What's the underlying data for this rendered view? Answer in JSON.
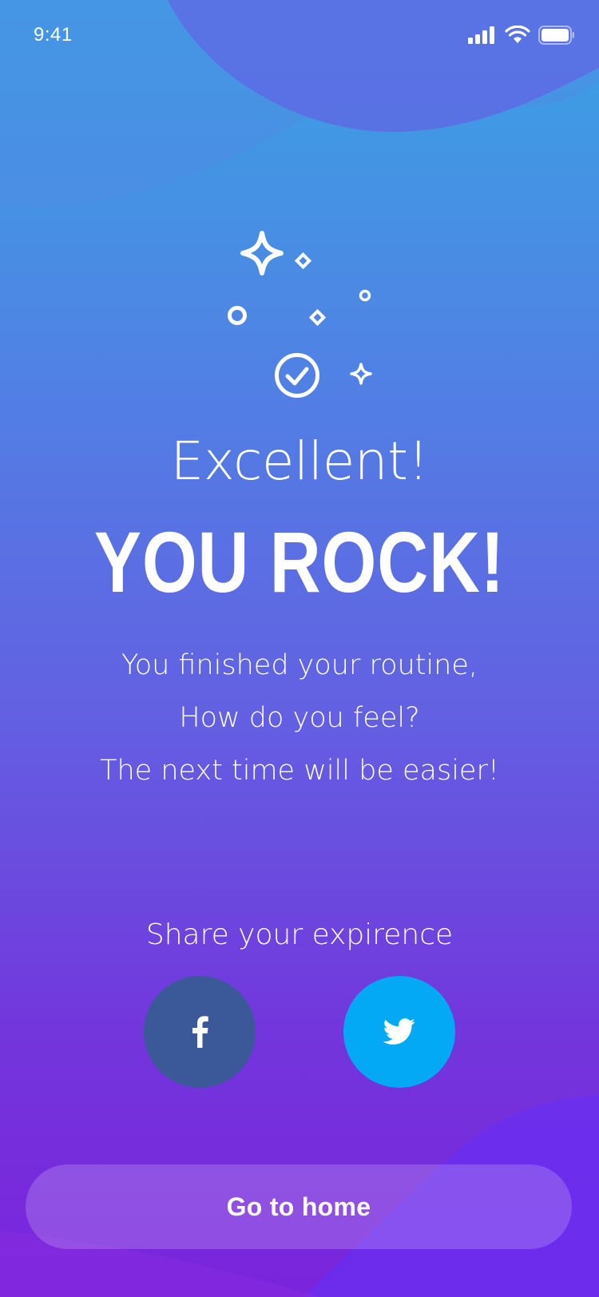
{
  "status_bar": {
    "time": "9:41",
    "icons": [
      "cellular-signal-icon",
      "wifi-icon",
      "battery-icon"
    ]
  },
  "illustration": {
    "icons": [
      "sparkle-icon",
      "checkmark-circle-icon"
    ]
  },
  "main": {
    "headline": "Excellent!",
    "title": "YOU ROCK!",
    "message_lines": [
      "You finished your routine,",
      "How do you feel?",
      "The next time will be easier!"
    ]
  },
  "share": {
    "label": "Share your expirence",
    "buttons": [
      {
        "network": "facebook",
        "icon": "facebook-icon",
        "color": "#3b5998"
      },
      {
        "network": "twitter",
        "icon": "twitter-icon",
        "color": "#03a9f4"
      }
    ]
  },
  "footer": {
    "home_label": "Go to home"
  },
  "colors": {
    "gradient_top": "#3aa3e3",
    "gradient_bottom": "#7a24dd",
    "text": "#ffffff"
  }
}
